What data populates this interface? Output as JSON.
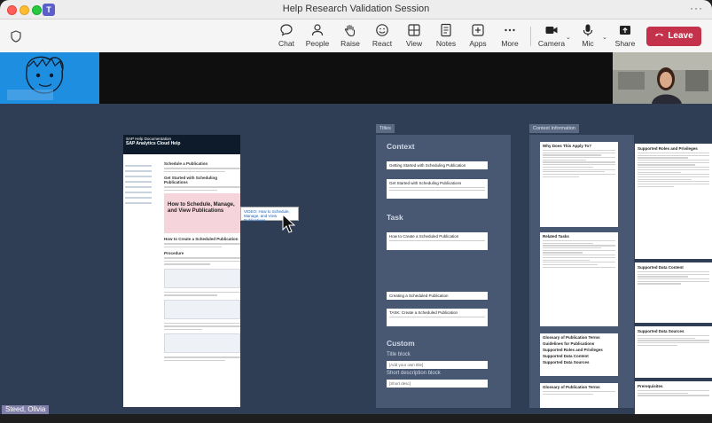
{
  "window": {
    "title": "Help Research Validation Session",
    "more": "···"
  },
  "toolbar": {
    "chat": "Chat",
    "people": "People",
    "raise": "Raise",
    "react": "React",
    "view": "View",
    "notes": "Notes",
    "apps": "Apps",
    "more": "More",
    "camera": "Camera",
    "mic": "Mic",
    "share": "Share",
    "leave": "Leave"
  },
  "participants": {
    "presenter_name": "Steed, Olivia"
  },
  "shared_doc": {
    "header_brand": "SAP Analytics Cloud Help",
    "header_sub": "SAP Help Documentation",
    "heading1": "Schedule a Publication",
    "heading2": "Get Started with Scheduling Publications",
    "video_text": "How to Schedule, Manage, and View Publications",
    "heading3": "How to Create a Scheduled Publication",
    "procedure": "Procedure",
    "tooltip_text": "VIDEO: How to Schedule, Manage, and View Publications"
  },
  "titles_panel": {
    "tab": "Titles",
    "context_heading": "Context",
    "card1": "Getting Started with Scheduling Publication",
    "card2": "Get Started with Scheduling Publications",
    "task_heading": "Task",
    "card3": "How to Create a Scheduled Publication",
    "card4": "Creating a Scheduled Publication",
    "card5": "TASK: Create a Scheduled Publication",
    "custom_heading": "Custom",
    "title_block_label": "Title block",
    "title_block_value": "[Add your own title]",
    "short_desc_label": "Short description block",
    "short_desc_value": "[Short desc]"
  },
  "context_panel": {
    "tab": "Context Information",
    "card1_title": "Why Does This Apply To?",
    "card2_title": "Related Tasks",
    "list1": "Glossary of Publication Terms",
    "list2": "Guidelines for Publications",
    "list3": "Supported Roles and Privileges",
    "list4": "Supported Data Content",
    "list5": "Supported Data Sources",
    "card3_title": "Glossary of Publication Terms"
  },
  "right_sheets": {
    "sheet1_title": "Supported Roles and Privileges",
    "sheet2_title": "Supported Data Content",
    "sheet3_title": "Supported Data Sources",
    "sheet4_title": "Prerequisites"
  }
}
